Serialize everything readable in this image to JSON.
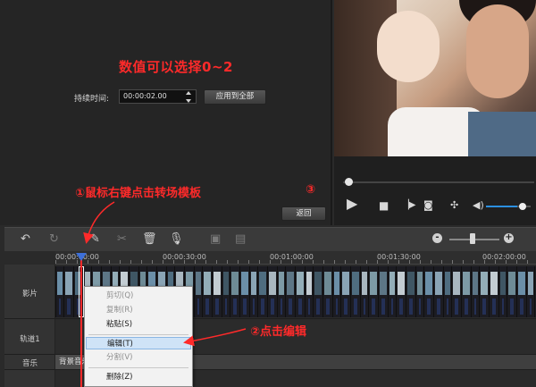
{
  "settings": {
    "annotation_top": "数值可以选择0~2",
    "duration_label": "持续时间:",
    "duration_value": "00:00:02.00",
    "apply_all_label": "应用到全部",
    "back_label": "返回",
    "annotation_step1": "①鼠标右键点击转场模板",
    "annotation_step3": "③"
  },
  "player": {
    "controls": [
      "play-icon",
      "stop-icon",
      "next-frame-icon",
      "snapshot-icon",
      "fullscreen-icon",
      "volume-icon"
    ],
    "volume_percent": 70,
    "progress_percent": 2
  },
  "toolbar": {
    "icons": [
      "undo-icon",
      "redo-icon",
      "edit-icon",
      "cut-icon",
      "delete-icon",
      "record-mic-icon",
      "screen-capture-icon",
      "card-icon"
    ],
    "zoom_minus": "-",
    "zoom_plus": "+",
    "zoom_level_percent": 45
  },
  "ruler": {
    "ticks": [
      "00:00:00:00",
      "00:00:30:00",
      "00:01:00:00",
      "00:01:30:00",
      "00:02:00:00"
    ]
  },
  "tracks": {
    "video": "影片",
    "overlay": "轨道1",
    "music": "音乐",
    "music_clip": "背景音乐"
  },
  "context_menu": {
    "items": [
      {
        "label": "剪切(Q)",
        "enabled": false
      },
      {
        "label": "复制(R)",
        "enabled": false
      },
      {
        "label": "粘贴(S)",
        "enabled": true
      },
      {
        "label": "编辑(T)",
        "enabled": true,
        "highlighted": true
      },
      {
        "label": "分割(V)",
        "enabled": false
      },
      {
        "label": "删除(Z)",
        "enabled": true
      }
    ]
  },
  "annotation_step2": "②点击编辑",
  "colors": {
    "annotation": "#ff2a2a",
    "accent": "#2b8fe0",
    "playhead_tip": "#3d6fd8"
  }
}
